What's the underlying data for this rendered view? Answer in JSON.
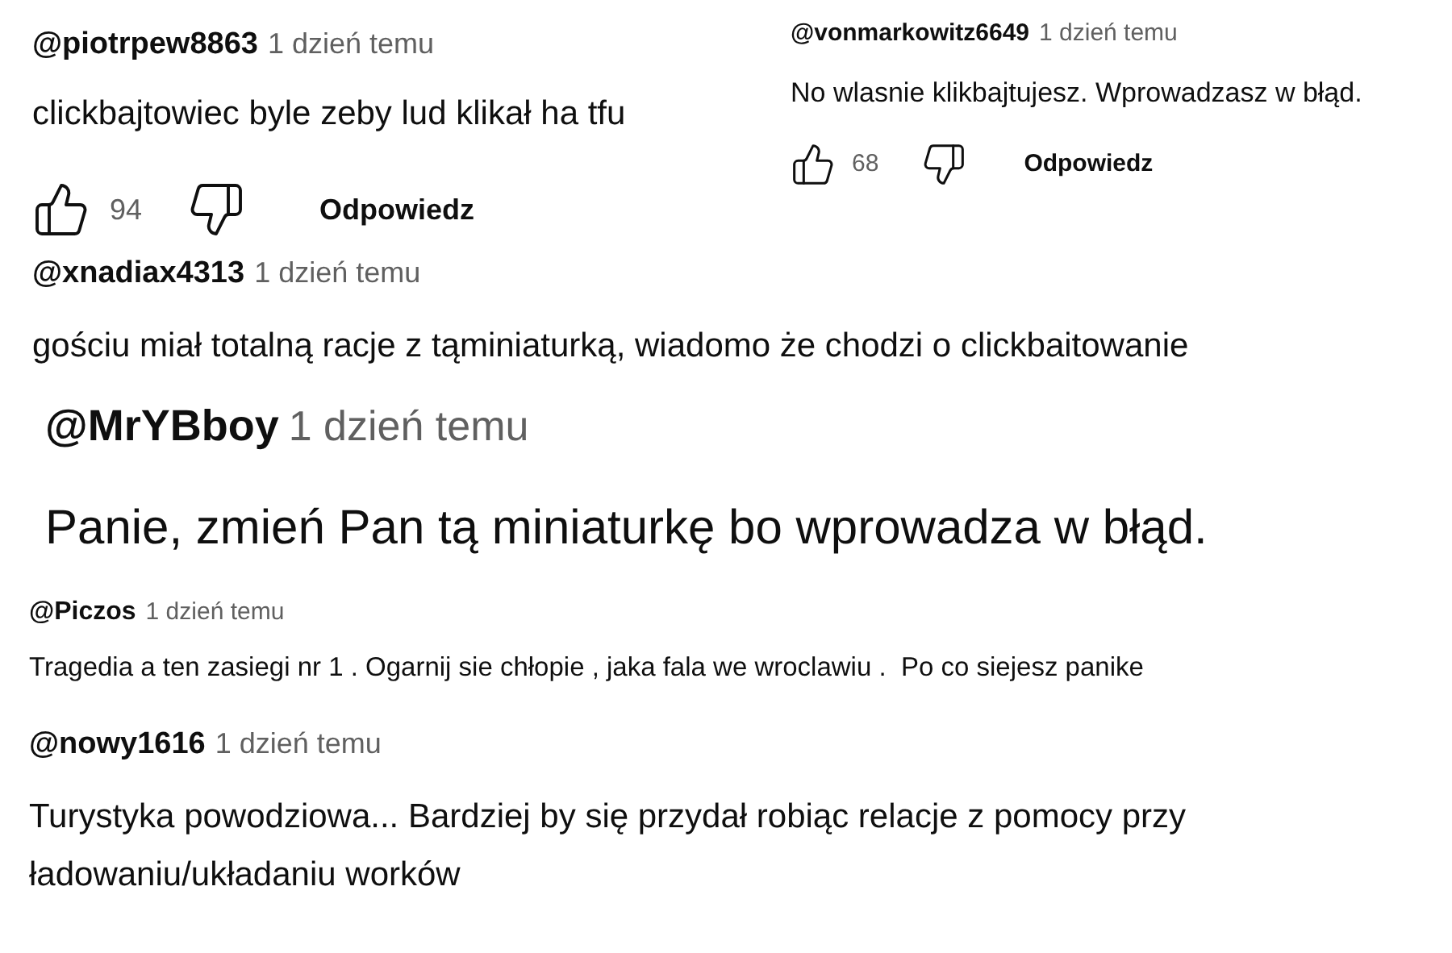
{
  "comments": [
    {
      "author": "@piotrpew8863",
      "time": "1 dzień temu",
      "text": "clickbajtowiec byle zeby lud klikał ha tfu",
      "likes": "94",
      "reply": "Odpowiedz"
    },
    {
      "author": "@vonmarkowitz6649",
      "time": "1 dzień temu",
      "text": "No wlasnie klikbajtujesz. Wprowadzasz w błąd.",
      "likes": "68",
      "reply": "Odpowiedz"
    },
    {
      "author": "@xnadiax4313",
      "time": "1 dzień temu",
      "text": "gościu miał totalną racje z tąminiaturką, wiadomo że chodzi o clickbaitowanie"
    },
    {
      "author": "@MrYBboy",
      "time": "1 dzień temu",
      "text": "Panie,  zmień Pan tą miniaturkę bo wprowadza w błąd."
    },
    {
      "author": "@Piczos",
      "time": "1 dzień temu",
      "text": "Tragedia a ten zasiegi nr 1 . Ogarnij sie chłopie , jaka fala we wroclawiu .  Po co siejesz panike"
    },
    {
      "author": "@nowy1616",
      "time": "1 dzień temu",
      "text": "Turystyka powodziowa... Bardziej by się przydał robiąc relacje z pomocy przy ładowaniu/układaniu worków"
    }
  ]
}
